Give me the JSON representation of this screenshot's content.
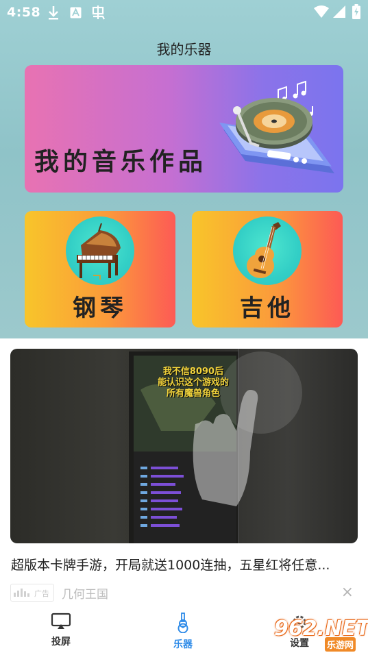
{
  "status_bar": {
    "time": "4:58",
    "icons_left": [
      "download-icon",
      "text-a-icon",
      "bug-icon"
    ],
    "icons_right": [
      "wifi-icon",
      "signal-icon",
      "battery-charging-icon"
    ]
  },
  "header": {
    "title": "我的乐器"
  },
  "works_banner": {
    "label": "我的音乐作品",
    "illustration": "record-player-phone-illustration"
  },
  "instruments": [
    {
      "label": "钢琴",
      "icon": "piano-icon"
    },
    {
      "label": "吉他",
      "icon": "guitar-icon"
    }
  ],
  "ad": {
    "video_overlay_text": [
      "我不信8090后",
      "能认识这个游戏的",
      "所有魔兽角色"
    ],
    "title": "超版本卡牌手游，开局就送1000连抽，五星红将任意...",
    "badge": "广告",
    "source": "几何王国",
    "close": "×"
  },
  "bottom_nav": {
    "items": [
      {
        "label": "投屏",
        "icon": "cast-screen-icon",
        "active": false
      },
      {
        "label": "乐器",
        "icon": "guitar-nav-icon",
        "active": true
      },
      {
        "label": "设置",
        "icon": "gear-icon",
        "active": false
      }
    ]
  },
  "watermark": {
    "main": "962.NET",
    "sub": "乐游网"
  },
  "colors": {
    "accent": "#2e8be8",
    "banner_start": "#e872b2",
    "banner_end": "#7b74ee",
    "card_start": "#f8c52a",
    "card_end": "#fd5a55",
    "icon_circle": "#33cfc6"
  }
}
